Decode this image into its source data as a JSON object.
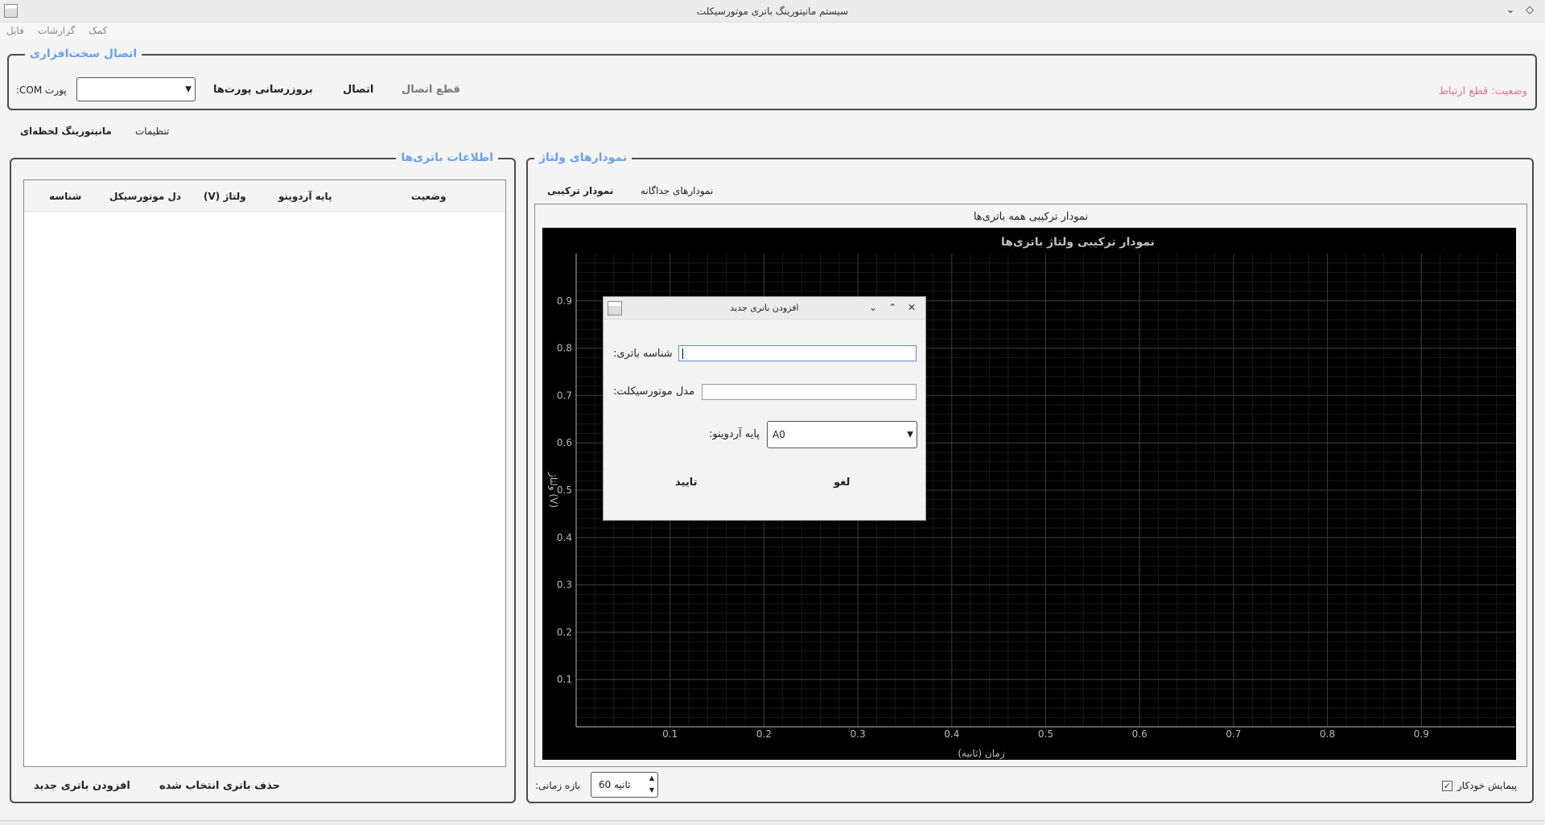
{
  "window": {
    "title": "سیستم مانیتورینگ باتری موتورسیکلت",
    "min_glyph": "⌄",
    "max_glyph": "◇"
  },
  "menu": {
    "file": "فایل",
    "reports": "گزارشات",
    "help": "کمک"
  },
  "hardware": {
    "title": "اتصال سخت‌افزاری",
    "port_label": "پورت COM:",
    "refresh_ports": "بروزرسانی پورت‌ها",
    "connect": "اتصال",
    "disconnect": "قطع اتصال",
    "status": "وضعیت: قطع ارتباط"
  },
  "main_tabs": {
    "realtime": "مانیتورینگ لحظه‌ای",
    "settings": "تنظیمات"
  },
  "battery_info": {
    "title": "اطلاعات باتری‌ها",
    "columns": [
      "شناسه",
      "دل موتورسیکل",
      "(V) ولتاژ",
      "پایه آردوینو",
      "وضعیت"
    ],
    "add_button": "افزودن باتری جدید",
    "delete_button": "حذف باتری انتخاب شده"
  },
  "voltage_charts": {
    "title": "نمودارهای ولتاژ",
    "tabs": {
      "combined": "نمودار ترکیبی",
      "separate": "نمودارهای جداگانه"
    },
    "panel_title": "نمودار ترکیبی همه باتری‌ها",
    "time_window_label": "بازه زمانی:",
    "time_window_value": "60 ثانیه",
    "autoscroll_label": "پیمایش خودکار",
    "autoscroll_checked": true
  },
  "chart_data": {
    "type": "line",
    "title": "نمودار ترکیبی ولتاژ باتری‌ها",
    "xlabel": "زمان (ثانیه)",
    "ylabel": "ولتاژ (V)",
    "xlim": [
      0,
      1
    ],
    "ylim": [
      0,
      1
    ],
    "x_ticks": [
      "0.1",
      "0.2",
      "0.3",
      "0.4",
      "0.5",
      "0.6",
      "0.7",
      "0.8",
      "0.9"
    ],
    "y_ticks": [
      "0.1",
      "0.2",
      "0.3",
      "0.4",
      "0.5",
      "0.6",
      "0.7",
      "0.8",
      "0.9"
    ],
    "grid": true,
    "series": []
  },
  "dialog": {
    "title": "افزودن باتری جدید",
    "battery_id_label": "شناسه باتری:",
    "battery_id_value": "",
    "model_label": "مدل موتورسیکلت:",
    "model_value": "",
    "pin_label": "پایه آردوینو:",
    "pin_value": "A0",
    "ok": "تایید",
    "cancel": "لغو"
  },
  "icons": {
    "window_icon": "window-icon",
    "close": "close-icon",
    "maximize": "maximize-icon",
    "minimize": "minimize-icon",
    "dropdown": "chevron-down-icon",
    "check": "check-icon"
  }
}
